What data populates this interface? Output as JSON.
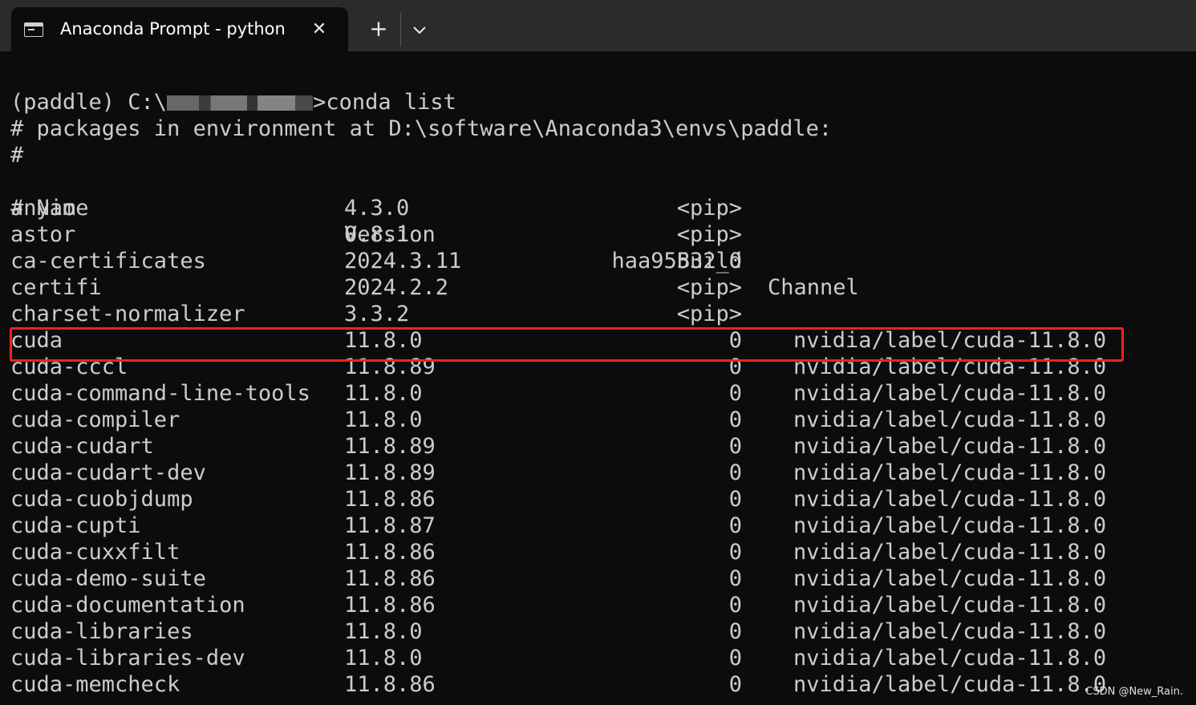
{
  "window": {
    "tab_title": "Anaconda Prompt - python",
    "tab_icon": "terminal-icon",
    "close_icon": "close-icon",
    "new_tab_label": "+",
    "dropdown_icon": "chevron-down-icon"
  },
  "terminal": {
    "prompt_prefix": "(paddle) C:\\",
    "prompt_command": ">conda list",
    "env_line": "# packages in environment at D:\\software\\Anaconda3\\envs\\paddle:",
    "hash_line": "#",
    "header": {
      "name": "# Name",
      "version": "Version",
      "build": "Build",
      "channel": "Channel"
    },
    "packages": [
      {
        "name": "anyio",
        "version": "4.3.0",
        "build": "<pip>",
        "channel": ""
      },
      {
        "name": "astor",
        "version": "0.8.1",
        "build": "<pip>",
        "channel": ""
      },
      {
        "name": "ca-certificates",
        "version": "2024.3.11",
        "build": "haa95532_0",
        "channel": ""
      },
      {
        "name": "certifi",
        "version": "2024.2.2",
        "build": "<pip>",
        "channel": ""
      },
      {
        "name": "charset-normalizer",
        "version": "3.3.2",
        "build": "<pip>",
        "channel": ""
      },
      {
        "name": "cuda",
        "version": "11.8.0",
        "build": "0",
        "channel": "nvidia/label/cuda-11.8.0"
      },
      {
        "name": "cuda-cccl",
        "version": "11.8.89",
        "build": "0",
        "channel": "nvidia/label/cuda-11.8.0"
      },
      {
        "name": "cuda-command-line-tools",
        "version": "11.8.0",
        "build": "0",
        "channel": "nvidia/label/cuda-11.8.0"
      },
      {
        "name": "cuda-compiler",
        "version": "11.8.0",
        "build": "0",
        "channel": "nvidia/label/cuda-11.8.0"
      },
      {
        "name": "cuda-cudart",
        "version": "11.8.89",
        "build": "0",
        "channel": "nvidia/label/cuda-11.8.0"
      },
      {
        "name": "cuda-cudart-dev",
        "version": "11.8.89",
        "build": "0",
        "channel": "nvidia/label/cuda-11.8.0"
      },
      {
        "name": "cuda-cuobjdump",
        "version": "11.8.86",
        "build": "0",
        "channel": "nvidia/label/cuda-11.8.0"
      },
      {
        "name": "cuda-cupti",
        "version": "11.8.87",
        "build": "0",
        "channel": "nvidia/label/cuda-11.8.0"
      },
      {
        "name": "cuda-cuxxfilt",
        "version": "11.8.86",
        "build": "0",
        "channel": "nvidia/label/cuda-11.8.0"
      },
      {
        "name": "cuda-demo-suite",
        "version": "11.8.86",
        "build": "0",
        "channel": "nvidia/label/cuda-11.8.0"
      },
      {
        "name": "cuda-documentation",
        "version": "11.8.86",
        "build": "0",
        "channel": "nvidia/label/cuda-11.8.0"
      },
      {
        "name": "cuda-libraries",
        "version": "11.8.0",
        "build": "0",
        "channel": "nvidia/label/cuda-11.8.0"
      },
      {
        "name": "cuda-libraries-dev",
        "version": "11.8.0",
        "build": "0",
        "channel": "nvidia/label/cuda-11.8.0"
      },
      {
        "name": "cuda-memcheck",
        "version": "11.8.86",
        "build": "0",
        "channel": "nvidia/label/cuda-11.8.0"
      }
    ],
    "highlighted_package": "cuda",
    "highlight_color": "#ff1f1f",
    "text_color": "#cccccc",
    "background_color": "#0c0c0c"
  },
  "watermark": "CSDN @New_Rain."
}
